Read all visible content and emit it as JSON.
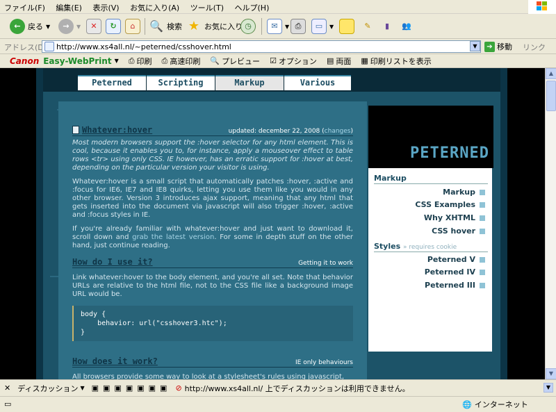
{
  "menubar": {
    "items": [
      "ファイル(F)",
      "編集(E)",
      "表示(V)",
      "お気に入り(A)",
      "ツール(T)",
      "ヘルプ(H)"
    ]
  },
  "toolbar": {
    "back_label": "戻る",
    "search_label": "検索",
    "favorites_label": "お気に入り"
  },
  "address": {
    "label": "アドレス(D)",
    "url": "http://www.xs4all.nl/~peterned/csshover.html",
    "go_label": "移動",
    "links_label": "リンク"
  },
  "canon": {
    "brand": "Canon",
    "product": "Easy-WebPrint",
    "print": "印刷",
    "hq_print": "高速印刷",
    "preview": "プレビュー",
    "options": "オプション",
    "duplex": "両面",
    "print_list": "印刷リストを表示"
  },
  "site": {
    "nav": [
      "Peterned",
      "Scripting",
      "Markup",
      "Various"
    ],
    "active_tab": "Markup",
    "banner": "PETERNED",
    "article": {
      "title": "Whatever:hover",
      "updated_prefix": "updated: december 22, 2008 (",
      "changes": "changes",
      "updated_suffix": ")",
      "intro": "Most modern browsers support the :hover selector for any html element. This is cool, because it enables you to, for instance, apply a mouseover effect to table rows <tr> using only CSS. IE however, has an erratic support for :hover at best, depending on the particular version your visitor is using.",
      "p1": "Whatever:hover is a small script that automatically patches :hover, :active and :focus for IE6, IE7 and IE8 quirks, letting you use them like you would in any other browser. Version 3 introduces ajax support, meaning that any html that gets inserted into the document via javascript will also trigger :hover, :active and :focus styles in IE.",
      "p2_before": "If you're already familiar with whatever:hover and just want to download it, scroll down and ",
      "p2_link": "grab the latest version",
      "p2_after": ". For some in depth stuff on the other hand, just continue reading.",
      "h_use": "How do I use it?",
      "h_use_side": "Getting it to work",
      "p3": "Link whatever:hover to the body element, and you're all set. Note that behavior URLs are relative to the html file, not to the CSS file like a background image URL would be.",
      "code": "body {\n    behavior: url(\"csshover3.htc\");\n}",
      "h_work": "How does it work?",
      "h_work_side": "IE only behaviours",
      "p4": "All browsers provide some way to look at a stylesheet's rules using javascript,"
    },
    "sidebar": {
      "markup_head": "Markup",
      "markup_items": [
        "Markup",
        "CSS Examples",
        "Why XHTML",
        "CSS hover"
      ],
      "styles_head": "Styles",
      "styles_note": "» requires cookie",
      "styles_items": [
        "Peterned V",
        "Peterned IV",
        "Peterned III"
      ]
    }
  },
  "discussion": {
    "label": "ディスカッション",
    "message": "http://www.xs4all.nl/ 上でディスカッションは利用できません。"
  },
  "status": {
    "zone": "インターネット"
  },
  "colors": {
    "site_bg": "#1c5368",
    "content_bg": "#2e6f86",
    "heading": "#0f3446",
    "link": "#a6d4e6"
  }
}
